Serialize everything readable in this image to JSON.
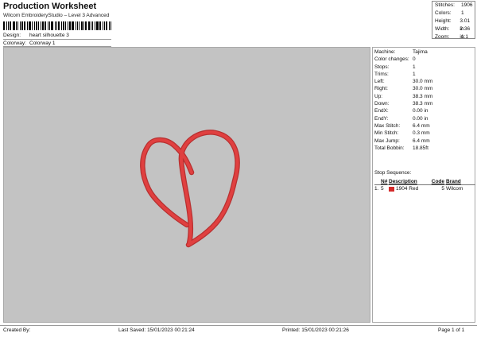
{
  "header": {
    "title": "Production Worksheet",
    "subtitle": "Wilcom EmbroideryStudio – Level 3 Advanced"
  },
  "meta": {
    "design_label": "Design:",
    "design_value": "heart silhouette 3",
    "colorway_label": "Colorway:",
    "colorway_value": "Colorway 1"
  },
  "stats": {
    "stitches_label": "Stitches:",
    "stitches_value": "1906",
    "colors_label": "Colors:",
    "colors_value": "1",
    "height_label": "Height:",
    "height_value": "3.01 in",
    "width_label": "Width:",
    "width_value": "2.36 in",
    "zoom_label": "Zoom:",
    "zoom_value": "1:1"
  },
  "info": [
    {
      "k": "Machine:",
      "v": "Tajima"
    },
    {
      "k": "Color changes:",
      "v": "0"
    },
    {
      "k": "Stops:",
      "v": "1"
    },
    {
      "k": "Trims:",
      "v": "1"
    },
    {
      "k": "Left:",
      "v": "30.0 mm"
    },
    {
      "k": "Right:",
      "v": "30.0 mm"
    },
    {
      "k": "Up:",
      "v": "38.3 mm"
    },
    {
      "k": "Down:",
      "v": "38.3 mm"
    },
    {
      "k": "EndX:",
      "v": "0.00 in"
    },
    {
      "k": "EndY:",
      "v": "0.00 in"
    },
    {
      "k": "Max Stitch:",
      "v": "6.4 mm"
    },
    {
      "k": "Min Stitch:",
      "v": "0.3 mm"
    },
    {
      "k": "Max Jump:",
      "v": "6.4 mm"
    },
    {
      "k": "Total Bobbin:",
      "v": "18.85ft"
    }
  ],
  "stop_sequence": {
    "title": "Stop Sequence:",
    "headers": {
      "n": "N#",
      "desc": "Description",
      "code": "Code",
      "brand": "Brand"
    },
    "rows": [
      {
        "idx": "1.",
        "n": "5",
        "count": "1904",
        "desc": "Red",
        "code": "5",
        "brand": "Wilcom",
        "color": "#d42a2a"
      }
    ]
  },
  "design_color": "#e04040",
  "footer": {
    "created_by": "Created By:",
    "last_saved": "Last Saved: 15/01/2023 00:21:24",
    "printed": "Printed: 15/01/2023 00:21:26",
    "page": "Page 1 of 1"
  }
}
